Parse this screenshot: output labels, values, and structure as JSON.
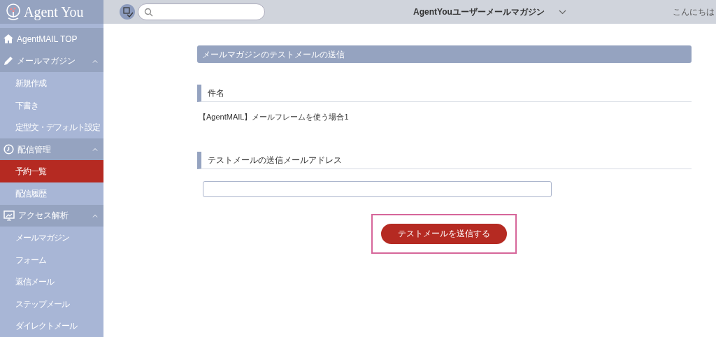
{
  "header": {
    "logo": "Agent You",
    "magazine_title": "AgentYouユーザーメールマガジン",
    "greeting": "こんにちは"
  },
  "sidebar": {
    "items": [
      {
        "kind": "link",
        "label": "AgentMAIL TOP"
      },
      {
        "kind": "group",
        "label": "メールマガジン",
        "expanded": true,
        "children": [
          {
            "label": "新規作成",
            "selected": false
          },
          {
            "label": "下書き",
            "selected": false
          },
          {
            "label": "定型文・デフォルト設定",
            "selected": false
          }
        ]
      },
      {
        "kind": "group",
        "label": "配信管理",
        "expanded": true,
        "children": [
          {
            "label": "予約一覧",
            "selected": true
          },
          {
            "label": "配信履歴",
            "selected": false
          }
        ]
      },
      {
        "kind": "group",
        "label": "アクセス解析",
        "expanded": true,
        "children": [
          {
            "label": "メールマガジン",
            "selected": false
          },
          {
            "label": "フォーム",
            "selected": false
          },
          {
            "label": "返信メール",
            "selected": false
          },
          {
            "label": "ステップメール",
            "selected": false
          },
          {
            "label": "ダイレクトメール",
            "selected": false
          }
        ]
      }
    ]
  },
  "main": {
    "title": "メールマガジンのテストメールの送信",
    "sections": [
      {
        "heading": "件名",
        "kind": "text",
        "value": "【AgentMAIL】メールフレームを使う場合1"
      },
      {
        "heading": "テストメールの送信メールアドレス",
        "kind": "input"
      }
    ],
    "send_button": {
      "label": "テストメールを送信する",
      "highlighted": true
    }
  }
}
